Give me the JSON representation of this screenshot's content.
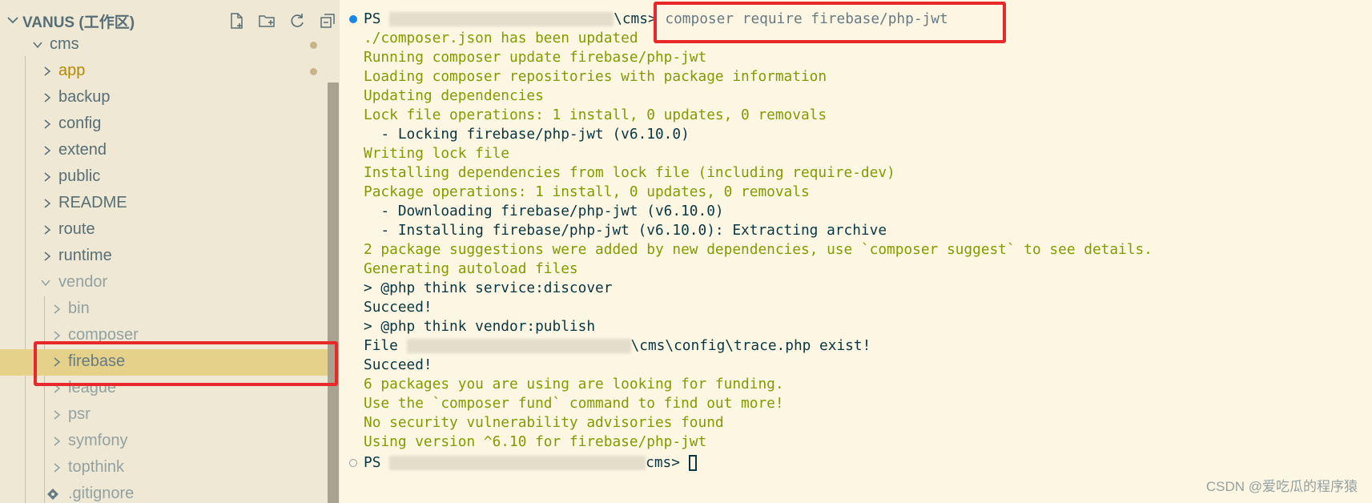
{
  "explorer": {
    "title": "VANUS (工作区)",
    "items": [
      {
        "label": "cms",
        "dim": false
      },
      {
        "label": "app",
        "dim": false
      },
      {
        "label": "backup",
        "dim": false
      },
      {
        "label": "config",
        "dim": false
      },
      {
        "label": "extend",
        "dim": false
      },
      {
        "label": "public",
        "dim": false
      },
      {
        "label": "README",
        "dim": false
      },
      {
        "label": "route",
        "dim": false
      },
      {
        "label": "runtime",
        "dim": false
      },
      {
        "label": "vendor",
        "dim": true
      },
      {
        "label": "bin",
        "dim": true
      },
      {
        "label": "composer",
        "dim": true
      },
      {
        "label": "firebase",
        "dim": true,
        "selected": true
      },
      {
        "label": "league",
        "dim": true
      },
      {
        "label": "psr",
        "dim": true
      },
      {
        "label": "symfony",
        "dim": true
      },
      {
        "label": "topthink",
        "dim": true
      },
      {
        "label": ".gitignore",
        "dim": true
      }
    ],
    "icons": [
      "new-file-icon",
      "new-folder-icon",
      "refresh-icon",
      "collapse-all-icon"
    ]
  },
  "terminal": {
    "prompt_prefix": "PS",
    "prompt_suffix": "\\cms>",
    "command": "composer require firebase/php-jwt",
    "lines": [
      "./composer.json has been updated",
      "Running composer update firebase/php-jwt",
      "Loading composer repositories with package information",
      "Updating dependencies",
      "Lock file operations: 1 install, 0 updates, 0 removals",
      "  - Locking firebase/php-jwt (v6.10.0)",
      "Writing lock file",
      "Installing dependencies from lock file (including require-dev)",
      "Package operations: 1 install, 0 updates, 0 removals",
      "  - Downloading firebase/php-jwt (v6.10.0)",
      "  - Installing firebase/php-jwt (v6.10.0): Extracting archive",
      "2 package suggestions were added by new dependencies, use `composer suggest` to see details.",
      "Generating autoload files",
      "> @php think service:discover",
      "Succeed!",
      "> @php think vendor:publish",
      "\\cms\\config\\trace.php exist!",
      "Succeed!",
      "6 packages you are using are looking for funding.",
      "Use the `composer fund` command to find out more!",
      "No security vulnerability advisories found",
      "Using version ^6.10 for firebase/php-jwt"
    ],
    "file_prefix": "File",
    "final_prompt_suffix": "cms>"
  },
  "watermark": "CSDN @爱吃瓜的程序猿",
  "colors": {
    "accent_dot": "#1a85e6",
    "highlight": "#e8282b",
    "selected_row": "#e6d18a",
    "sidebar_bg": "#eee8d5",
    "terminal_bg": "#fdf6e3"
  }
}
